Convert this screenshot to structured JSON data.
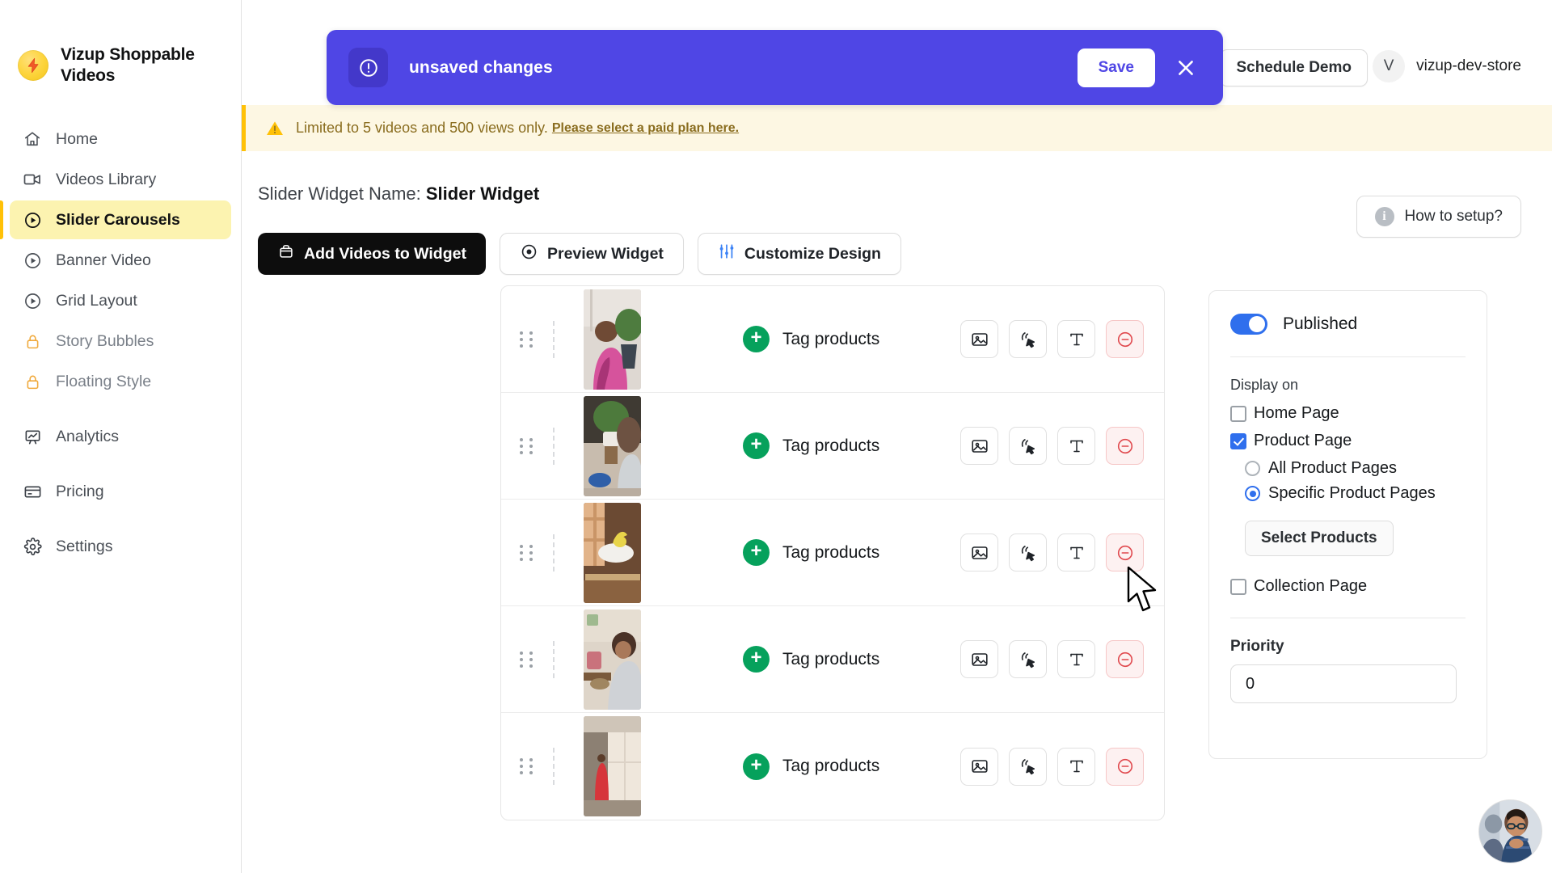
{
  "brand": {
    "title": "Vizup Shoppable Videos",
    "logo_icon": "lightning-bolt-icon"
  },
  "sidebar": {
    "items": [
      {
        "label": "Home",
        "icon": "home-icon",
        "active": false,
        "locked": false
      },
      {
        "label": "Videos Library",
        "icon": "video-camera-icon",
        "active": false,
        "locked": false
      },
      {
        "label": "Slider Carousels",
        "icon": "play-circle-icon",
        "active": true,
        "locked": false
      },
      {
        "label": "Banner Video",
        "icon": "play-circle-icon",
        "active": false,
        "locked": false
      },
      {
        "label": "Grid Layout",
        "icon": "play-circle-icon",
        "active": false,
        "locked": false
      },
      {
        "label": "Story Bubbles",
        "icon": "lock-icon",
        "active": false,
        "locked": true
      },
      {
        "label": "Floating Style",
        "icon": "lock-icon",
        "active": false,
        "locked": true
      },
      {
        "label": "Analytics",
        "icon": "analytics-chart-icon",
        "active": false,
        "locked": false
      },
      {
        "label": "Pricing",
        "icon": "credit-card-icon",
        "active": false,
        "locked": false
      },
      {
        "label": "Settings",
        "icon": "gear-icon",
        "active": false,
        "locked": false
      }
    ]
  },
  "header": {
    "schedule_demo_label": "Schedule Demo",
    "store_initial": "V",
    "store_name": "vizup-dev-store"
  },
  "unsaved_banner": {
    "message": "unsaved changes",
    "save_label": "Save",
    "icon": "alert-circle-icon",
    "close_icon": "close-icon",
    "background_color": "#4f46e5"
  },
  "warning_banner": {
    "icon": "warning-triangle-icon",
    "text": "Limited to 5 videos and 500 views only.",
    "link_text": "Please select a paid plan here.",
    "background_color": "#fdf7e3",
    "accent_color": "#ffc107"
  },
  "page": {
    "widget_name_prefix": "Slider Widget Name:",
    "widget_name": "Slider Widget",
    "how_to_setup_label": "How to setup?"
  },
  "toolbar": {
    "add_videos_label": "Add Videos to Widget",
    "preview_label": "Preview Widget",
    "customize_label": "Customize Design"
  },
  "video_list": {
    "rows": [
      {
        "tag_label": "Tag products",
        "thumb": "woman-pink-dress-plant"
      },
      {
        "tag_label": "Tag products",
        "thumb": "woman-watering-plant"
      },
      {
        "tag_label": "Tag products",
        "thumb": "yellow-flower-bowl-table"
      },
      {
        "tag_label": "Tag products",
        "thumb": "woman-grey-dress-pooja"
      },
      {
        "tag_label": "Tag products",
        "thumb": "woman-red-outfit-corridor"
      }
    ],
    "row_icons": [
      {
        "name": "image-icon",
        "style": "default"
      },
      {
        "name": "click-cursor-icon",
        "style": "default"
      },
      {
        "name": "text-icon",
        "style": "default"
      },
      {
        "name": "remove-circle-icon",
        "style": "danger"
      }
    ],
    "drag_handle_icon": "drag-dots-icon",
    "add_tag_icon": "plus-icon"
  },
  "settings": {
    "published_label": "Published",
    "published_on": true,
    "display_on_label": "Display on",
    "checkboxes": [
      {
        "label": "Home Page",
        "checked": false
      },
      {
        "label": "Product Page",
        "checked": true
      },
      {
        "label": "Collection Page",
        "checked": false
      }
    ],
    "radios": [
      {
        "label": "All Product Pages",
        "checked": false
      },
      {
        "label": "Specific Product Pages",
        "checked": true
      }
    ],
    "select_products_label": "Select Products",
    "priority_label": "Priority",
    "priority_value": "0",
    "accent_color": "#2f6fed"
  },
  "chat": {
    "avatar_icon": "support-agent-avatar"
  }
}
